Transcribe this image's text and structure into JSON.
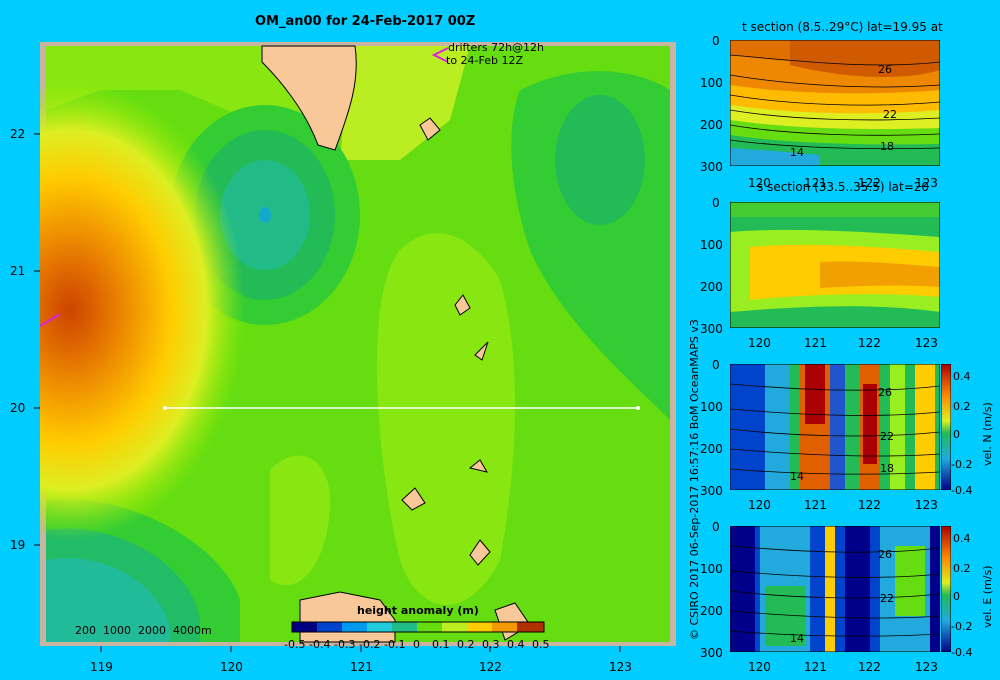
{
  "main_map": {
    "title": "OM_an00 for 24-Feb-2017 00Z",
    "drifters_line1": "drifters 72h@12h",
    "drifters_line2": "to 24-Feb 12Z",
    "lat_ticks": [
      "22",
      "21",
      "20",
      "19"
    ],
    "lon_ticks": [
      "119",
      "120",
      "121",
      "122",
      "123"
    ],
    "depth_legend": "200  1000  2000  4000m",
    "colorbar_title": "height anomaly (m)",
    "colorbar_ticks": [
      "-0.5",
      "-0.4",
      "-0.3",
      "-0.2",
      "-0.1",
      "0",
      "0.1",
      "0.2",
      "0.3",
      "0.4",
      "0.5"
    ]
  },
  "credit": "© CSIRO 2017   06-Sep-2017 16:57:16 BoM OceanMAPS v3",
  "colors": {
    "background": "#00ccff",
    "land": "#f8c898",
    "frame": "#c8b4a0"
  },
  "panels": [
    {
      "id": "t-section",
      "title": "t section (8.5..29°C) lat=19.95 at",
      "y_ticks": [
        "0",
        "100",
        "200",
        "300"
      ],
      "x_ticks": [
        "120",
        "121",
        "122",
        "123"
      ],
      "contour_labels": [
        "26",
        "22",
        "18",
        "14"
      ]
    },
    {
      "id": "s-section",
      "title": "s section (33.5..35.5) lat=20",
      "y_ticks": [
        "0",
        "100",
        "200",
        "300"
      ],
      "x_ticks": [
        "120",
        "121",
        "122",
        "123"
      ]
    },
    {
      "id": "vn-section",
      "title": "",
      "y_ticks": [
        "0",
        "100",
        "200",
        "300"
      ],
      "x_ticks": [
        "120",
        "121",
        "122",
        "123"
      ],
      "contour_labels": [
        "26",
        "22",
        "18",
        "14"
      ],
      "colorbar_label": "vel. N (m/s)",
      "colorbar_ticks": [
        "0.4",
        "0.2",
        "0",
        "-0.2",
        "-0.4"
      ]
    },
    {
      "id": "ve-section",
      "title": "",
      "y_ticks": [
        "0",
        "100",
        "200",
        "300"
      ],
      "x_ticks": [
        "120",
        "121",
        "122",
        "123"
      ],
      "contour_labels": [
        "26",
        "22",
        "14"
      ],
      "colorbar_label": "vel. E (m/s)",
      "colorbar_ticks": [
        "0.4",
        "0.2",
        "0",
        "-0.2",
        "-0.4"
      ]
    }
  ]
}
